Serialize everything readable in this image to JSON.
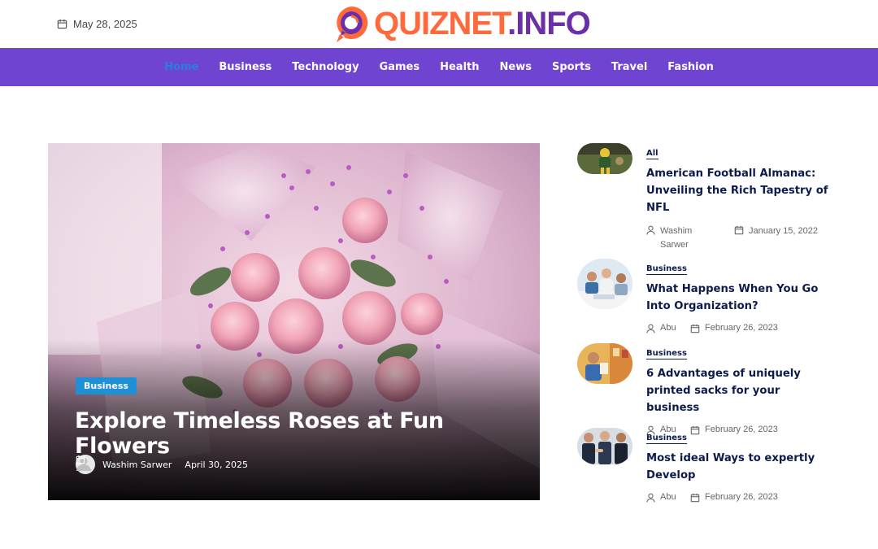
{
  "header": {
    "date": "May 28, 2025",
    "logo_part1": "QUIZNET",
    "logo_part2": ".INFO"
  },
  "nav": {
    "items": [
      "Home",
      "Business",
      "Technology",
      "Games",
      "Health",
      "News",
      "Sports",
      "Travel",
      "Fashion"
    ],
    "active": "Home"
  },
  "hero": {
    "category": "Business",
    "title": "Explore Timeless Roses at Fun Flowers",
    "author": "Washim Sarwer",
    "date": "April 30, 2025"
  },
  "sidebar": {
    "posts": [
      {
        "category": "All",
        "title": "American Football Almanac: Unveiling the Rich Tapestry of NFL",
        "author": "Washim Sarwer",
        "date": "January 15, 2022"
      },
      {
        "category": "Business",
        "title": "What Happens When You Go Into Organization?",
        "author": "Abu",
        "date": "February 26, 2023"
      },
      {
        "category": "Business",
        "title": "6 Advantages of uniquely printed sacks for your business",
        "author": "Abu",
        "date": "February 26, 2023"
      },
      {
        "category": "Business",
        "title": "Most ideal Ways to expertly Develop",
        "author": "Abu",
        "date": "February 26, 2023"
      }
    ]
  },
  "colors": {
    "nav_bg": "#6e44d1",
    "nav_active": "#2a7de1",
    "badge_bg": "#1f8fd6",
    "heading": "#0d1b4b",
    "logo_orange": "#ff6a3d",
    "logo_purple": "#6b2fa8"
  }
}
